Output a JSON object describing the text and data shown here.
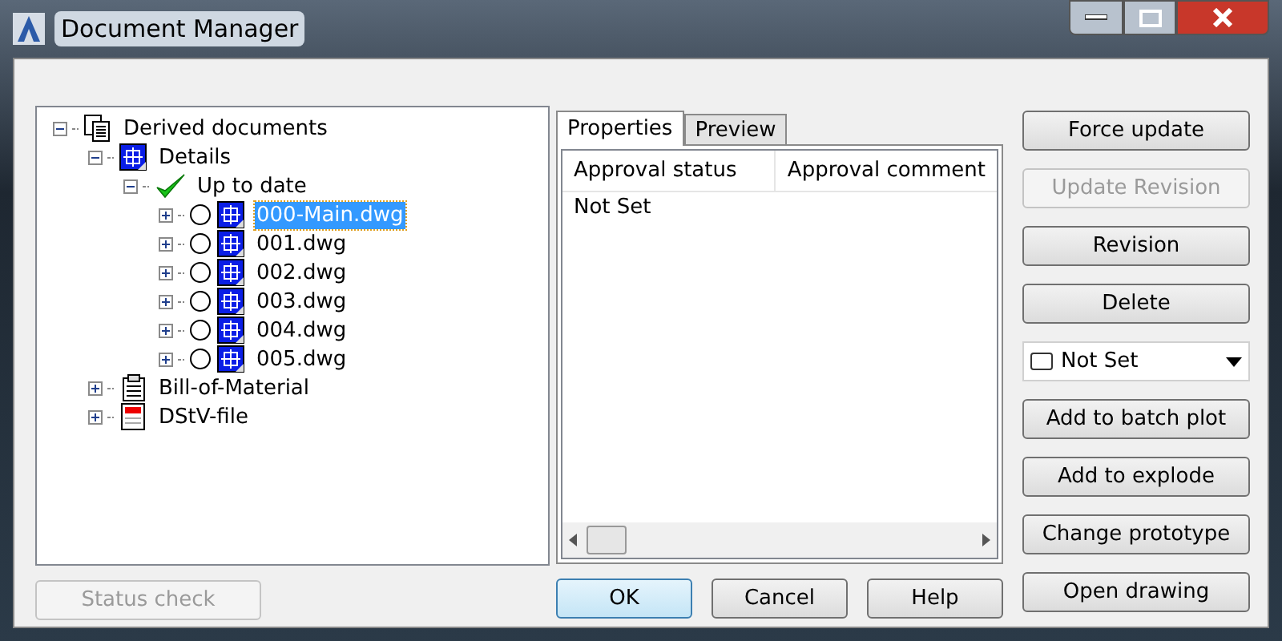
{
  "window": {
    "title": "Document Manager"
  },
  "tree": [
    {
      "label": "Derived documents",
      "kind": "documents",
      "expanded": true,
      "selected": false,
      "children": [
        {
          "label": "Details",
          "kind": "drawing",
          "expanded": true,
          "selected": false,
          "children": [
            {
              "label": "Up to date",
              "kind": "check",
              "expanded": true,
              "selected": false,
              "children": [
                {
                  "label": "000-Main.dwg",
                  "kind": "file",
                  "expanded": false,
                  "selected": true
                },
                {
                  "label": "001.dwg",
                  "kind": "file",
                  "expanded": false,
                  "selected": false
                },
                {
                  "label": "002.dwg",
                  "kind": "file",
                  "expanded": false,
                  "selected": false
                },
                {
                  "label": "003.dwg",
                  "kind": "file",
                  "expanded": false,
                  "selected": false
                },
                {
                  "label": "004.dwg",
                  "kind": "file",
                  "expanded": false,
                  "selected": false
                },
                {
                  "label": "005.dwg",
                  "kind": "file",
                  "expanded": false,
                  "selected": false
                }
              ]
            }
          ]
        },
        {
          "label": "Bill-of-Material",
          "kind": "bom",
          "expanded": false,
          "selected": false
        },
        {
          "label": "DStV-file",
          "kind": "dstv",
          "expanded": false,
          "selected": false
        }
      ]
    }
  ],
  "tabs": [
    {
      "label": "Properties",
      "selected": true
    },
    {
      "label": "Preview",
      "selected": false
    }
  ],
  "table": {
    "columns": [
      "Approval status",
      "Approval comment"
    ],
    "rows": [
      [
        "Not Set"
      ]
    ]
  },
  "side_buttons": [
    {
      "kind": "button",
      "label": "Force update",
      "disabled": false
    },
    {
      "kind": "button",
      "label": "Update Revision",
      "disabled": true
    },
    {
      "kind": "button",
      "label": "Revision",
      "disabled": false
    },
    {
      "kind": "button",
      "label": "Delete",
      "disabled": false
    },
    {
      "kind": "dropdown",
      "label": "Not Set",
      "disabled": false
    },
    {
      "kind": "button",
      "label": "Add to batch plot",
      "disabled": false
    },
    {
      "kind": "button",
      "label": "Add to explode",
      "disabled": false
    },
    {
      "kind": "button",
      "label": "Change prototype",
      "disabled": false
    },
    {
      "kind": "button",
      "label": "Open drawing",
      "disabled": false
    }
  ],
  "status_check": {
    "label": "Status check",
    "disabled": true
  },
  "bottom_buttons": [
    {
      "label": "OK",
      "default": true
    },
    {
      "label": "Cancel",
      "default": false
    },
    {
      "label": "Help",
      "default": false
    }
  ]
}
